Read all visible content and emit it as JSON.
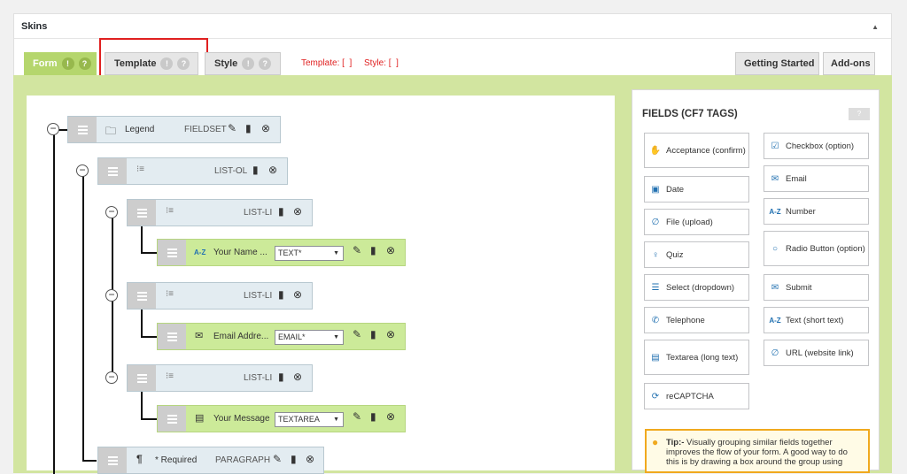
{
  "panel": {
    "title": "Skins",
    "collapse_icon": "triangle-up-icon"
  },
  "tabs": {
    "form": "Form",
    "template": "Template",
    "style": "Style",
    "badge_info": "!",
    "badge_help": "?",
    "template_status": "Template: [  ]",
    "style_status": "Style: [  ]",
    "getting_started": "Getting Started",
    "addons": "Add-ons"
  },
  "tree": {
    "legend": {
      "label": "Legend",
      "type": "FIELDSET"
    },
    "list_ol": {
      "type": "LIST-OL"
    },
    "list_li_1": {
      "type": "LIST-LI"
    },
    "field_name": {
      "label": "Your Name ...",
      "select": "TEXT*"
    },
    "list_li_2": {
      "type": "LIST-LI"
    },
    "field_email": {
      "label": "Email Addre...",
      "select": "EMAIL*"
    },
    "list_li_3": {
      "type": "LIST-LI"
    },
    "field_message": {
      "label": "Your Message",
      "select": "TEXTAREA"
    },
    "paragraph": {
      "label": "* Required",
      "type": "PARAGRAPH"
    },
    "az": "A-Z"
  },
  "fields_panel": {
    "title": "FIELDS (CF7 TAGS)",
    "help": "?",
    "left": [
      "Acceptance (confirm)",
      "Date",
      "File (upload)",
      "Quiz",
      "Select (dropdown)",
      "Telephone",
      "Textarea (long text)",
      "reCAPTCHA"
    ],
    "right": [
      "Checkbox (option)",
      "Email",
      "Number",
      "Radio Button (option)",
      "Submit",
      "Text (short text)",
      "URL (website link)"
    ]
  },
  "tip": {
    "bold": "Tip:-",
    "text": " Visually grouping similar fields together improves the flow of your form. A good way to do this is by drawing a box around the group using"
  },
  "colors": {
    "accent_red": "#e02020",
    "form_tab_green": "#b5d66d",
    "canvas_green": "#d2e5a0",
    "tip_border": "#f0a91e"
  }
}
